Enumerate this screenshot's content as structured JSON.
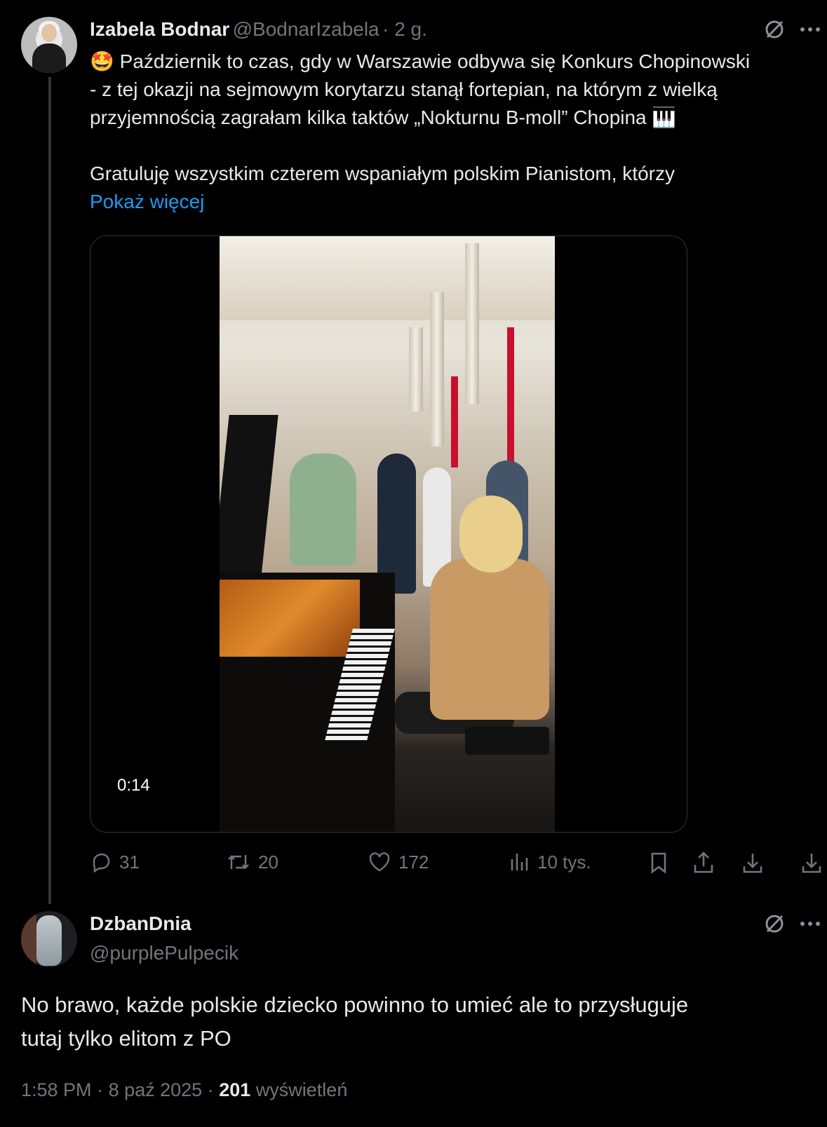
{
  "post": {
    "author_name": "Izabela Bodnar",
    "author_handle": "@BodnarIzabela",
    "time": "· 2 g.",
    "line1_emoji": "🤩",
    "line1": "Październik to czas, gdy w Warszawie odbywa się Konkurs Chopinowski",
    "line2": "- z tej okazji na sejmowym korytarzu stanął fortepian, na którym z wielką",
    "line3": "przyjemnością zagrałam kilka taktów „Nokturnu B-moll” Chopina",
    "line3_emoji": "🎹",
    "line4": "Gratuluję wszystkim czterem wspaniałym polskim Pianistom, którzy",
    "show_more": "Pokaż więcej",
    "video_duration": "0:14",
    "replies": "31",
    "reposts": "20",
    "likes": "172",
    "views": "10 tys."
  },
  "reply": {
    "author_name": "DzbanDnia",
    "author_handle": "@purplePulpecik",
    "text_line1": "No brawo, każde polskie dziecko powinno to umieć ale to przysługuje",
    "text_line2": "tutaj tylko elitom z PO",
    "time": "1:58 PM",
    "date": "8 paź 2025",
    "views_count": "201",
    "views_label": "wyświetleń"
  },
  "icons": [
    "grok-icon",
    "more-icon",
    "reply-icon",
    "repost-icon",
    "like-icon",
    "views-icon",
    "bookmark-icon",
    "share-icon",
    "download-icon"
  ]
}
